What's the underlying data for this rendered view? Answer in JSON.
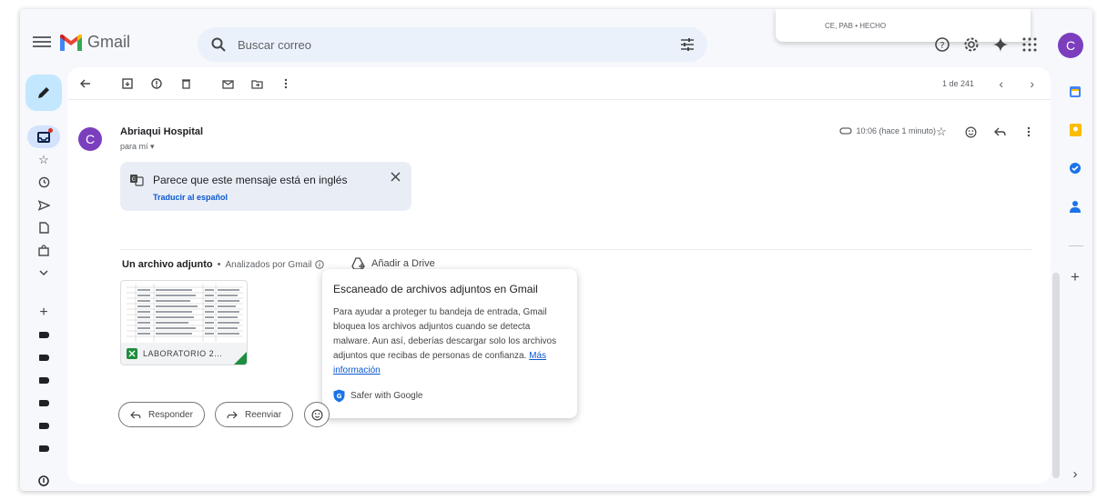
{
  "app": {
    "name": "Gmail"
  },
  "search": {
    "placeholder": "Buscar correo"
  },
  "popup_top": {
    "text": "CE, PAB • HECHO"
  },
  "user": {
    "initial": "C",
    "avatar_color": "#7b3fbe"
  },
  "rail": {
    "items": [
      {
        "name": "inbox-icon"
      },
      {
        "name": "star-icon"
      },
      {
        "name": "clock-icon"
      },
      {
        "name": "send-icon"
      },
      {
        "name": "draft-icon"
      },
      {
        "name": "purchases-icon"
      },
      {
        "name": "chevron-down-icon"
      }
    ],
    "label_count": 6
  },
  "toolbar": {
    "pager": "1 de 241"
  },
  "message": {
    "sender_initial": "C",
    "sender": "Abriaqui Hospital",
    "recipient": "para mí",
    "time": "10:06 (hace 1 minuto)"
  },
  "translate": {
    "message": "Parece que este mensaje está en inglés",
    "link": "Traducir al español"
  },
  "attachments": {
    "title": "Un archivo adjunto",
    "scanned": "Analizados por Gmail",
    "drive": "Añadir a Drive",
    "file_name": "LABORATORIO 2..."
  },
  "tooltip": {
    "title": "Escaneado de archivos adjuntos en Gmail",
    "body": "Para ayudar a proteger tu bandeja de entrada, Gmail bloquea los archivos adjuntos cuando se detecta malware. Aun así, deberías descargar solo los archivos adjuntos que recibas de personas de confianza.",
    "link": "Más información",
    "safe": "Safer with Google"
  },
  "actions": {
    "reply": "Responder",
    "forward": "Reenviar"
  },
  "colors": {
    "accent": "#0b57d0",
    "compose_bg": "#c2e7ff",
    "search_bg": "#eaf1fb",
    "frame_bg": "#f6f8fc"
  }
}
